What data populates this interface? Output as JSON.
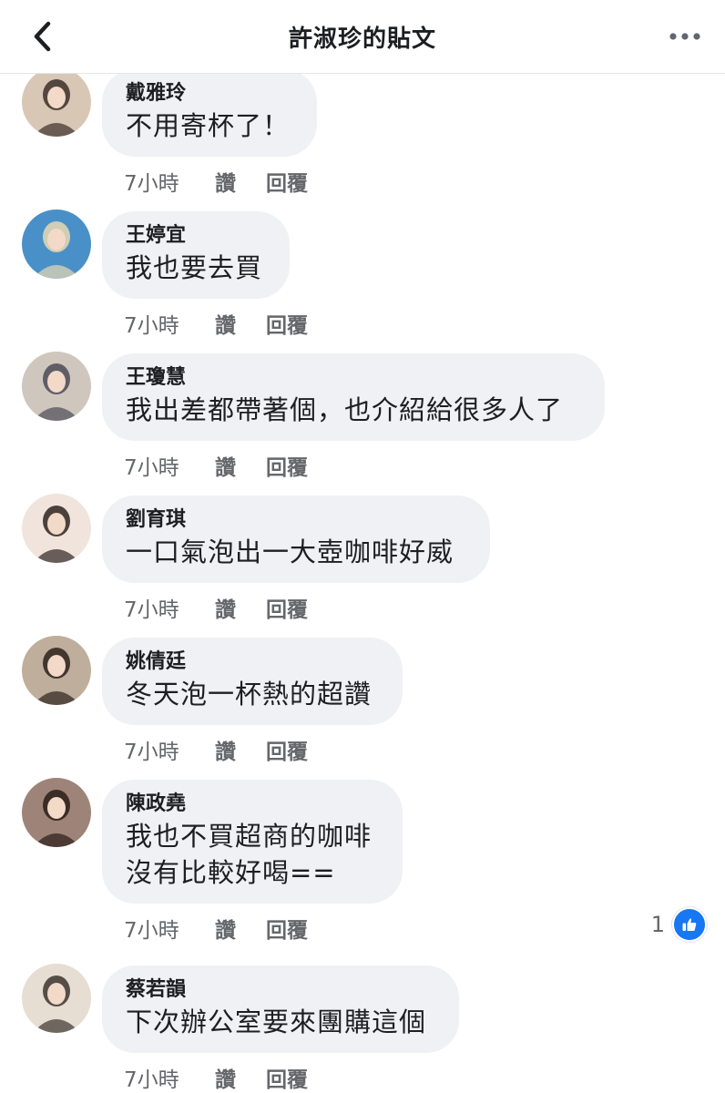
{
  "header": {
    "title": "許淑珍的貼文",
    "back_icon": "chevron-left-icon",
    "more_icon": "more-dots-icon"
  },
  "action_labels": {
    "like": "讚",
    "reply": "回覆"
  },
  "comments": [
    {
      "author": "戴雅玲",
      "lines": [
        "不用寄杯了！"
      ],
      "time": "7小時",
      "avatar_colors": [
        "#d9c7b6",
        "#3a2f2a"
      ]
    },
    {
      "author": "王婷宜",
      "lines": [
        "我也要去買"
      ],
      "time": "7小時",
      "avatar_colors": [
        "#4a90c8",
        "#e8d9b0"
      ]
    },
    {
      "author": "王瓊慧",
      "lines": [
        "我出差都帶著個，也介紹給很多人了"
      ],
      "time": "7小時",
      "avatar_colors": [
        "#cfc6bd",
        "#4b4b58"
      ]
    },
    {
      "author": "劉育琪",
      "lines": [
        "一口氣泡出一大壺咖啡好威"
      ],
      "time": "7小時",
      "avatar_colors": [
        "#f1e4dc",
        "#2e2420"
      ]
    },
    {
      "author": "姚倩廷",
      "lines": [
        "冬天泡一杯熱的超讚"
      ],
      "time": "7小時",
      "avatar_colors": [
        "#bfae9c",
        "#2b211c"
      ]
    },
    {
      "author": "陳政堯",
      "lines": [
        "我也不買超商的咖啡",
        "沒有比較好喝=="
      ],
      "time": "7小時",
      "avatar_colors": [
        "#9e8478",
        "#2a1c18"
      ],
      "reaction_count": "1",
      "reaction_icon": "thumbs-up-icon"
    },
    {
      "author": "蔡若韻",
      "lines": [
        "下次辦公室要來團購這個"
      ],
      "time": "7小時",
      "avatar_colors": [
        "#e6ddd3",
        "#3b342f"
      ]
    }
  ]
}
